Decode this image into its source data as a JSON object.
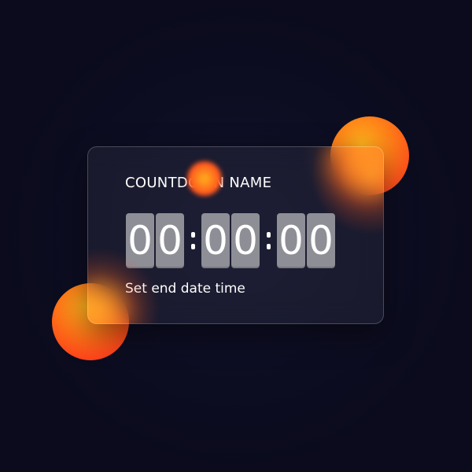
{
  "countdown": {
    "title": "COUNTDOWN NAME",
    "hours": [
      "0",
      "0"
    ],
    "minutes": [
      "0",
      "0"
    ],
    "seconds": [
      "0",
      "0"
    ],
    "separator": ":",
    "action_label": "Set end date time"
  },
  "colors": {
    "background": "#0b0b1d",
    "orb_start": "#ffb21c",
    "orb_end": "#ff2e1f",
    "digit_tile": "#8e8e96",
    "text": "#ffffff"
  }
}
